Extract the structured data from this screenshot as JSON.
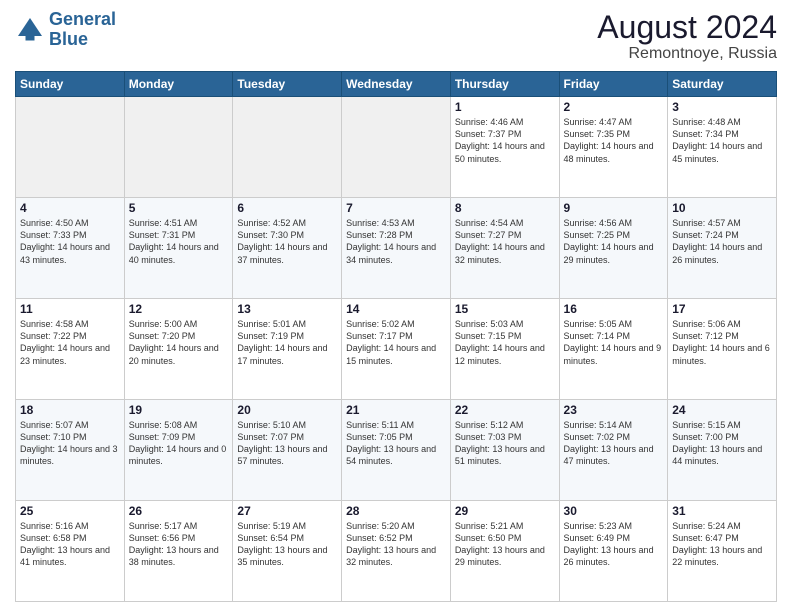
{
  "header": {
    "logo_line1": "General",
    "logo_line2": "Blue",
    "month": "August 2024",
    "location": "Remontnoye, Russia"
  },
  "weekdays": [
    "Sunday",
    "Monday",
    "Tuesday",
    "Wednesday",
    "Thursday",
    "Friday",
    "Saturday"
  ],
  "weeks": [
    [
      {
        "day": "",
        "empty": true
      },
      {
        "day": "",
        "empty": true
      },
      {
        "day": "",
        "empty": true
      },
      {
        "day": "",
        "empty": true
      },
      {
        "day": "1",
        "sunrise": "4:46 AM",
        "sunset": "7:37 PM",
        "daylight": "14 hours and 50 minutes."
      },
      {
        "day": "2",
        "sunrise": "4:47 AM",
        "sunset": "7:35 PM",
        "daylight": "14 hours and 48 minutes."
      },
      {
        "day": "3",
        "sunrise": "4:48 AM",
        "sunset": "7:34 PM",
        "daylight": "14 hours and 45 minutes."
      }
    ],
    [
      {
        "day": "4",
        "sunrise": "4:50 AM",
        "sunset": "7:33 PM",
        "daylight": "14 hours and 43 minutes."
      },
      {
        "day": "5",
        "sunrise": "4:51 AM",
        "sunset": "7:31 PM",
        "daylight": "14 hours and 40 minutes."
      },
      {
        "day": "6",
        "sunrise": "4:52 AM",
        "sunset": "7:30 PM",
        "daylight": "14 hours and 37 minutes."
      },
      {
        "day": "7",
        "sunrise": "4:53 AM",
        "sunset": "7:28 PM",
        "daylight": "14 hours and 34 minutes."
      },
      {
        "day": "8",
        "sunrise": "4:54 AM",
        "sunset": "7:27 PM",
        "daylight": "14 hours and 32 minutes."
      },
      {
        "day": "9",
        "sunrise": "4:56 AM",
        "sunset": "7:25 PM",
        "daylight": "14 hours and 29 minutes."
      },
      {
        "day": "10",
        "sunrise": "4:57 AM",
        "sunset": "7:24 PM",
        "daylight": "14 hours and 26 minutes."
      }
    ],
    [
      {
        "day": "11",
        "sunrise": "4:58 AM",
        "sunset": "7:22 PM",
        "daylight": "14 hours and 23 minutes."
      },
      {
        "day": "12",
        "sunrise": "5:00 AM",
        "sunset": "7:20 PM",
        "daylight": "14 hours and 20 minutes."
      },
      {
        "day": "13",
        "sunrise": "5:01 AM",
        "sunset": "7:19 PM",
        "daylight": "14 hours and 17 minutes."
      },
      {
        "day": "14",
        "sunrise": "5:02 AM",
        "sunset": "7:17 PM",
        "daylight": "14 hours and 15 minutes."
      },
      {
        "day": "15",
        "sunrise": "5:03 AM",
        "sunset": "7:15 PM",
        "daylight": "14 hours and 12 minutes."
      },
      {
        "day": "16",
        "sunrise": "5:05 AM",
        "sunset": "7:14 PM",
        "daylight": "14 hours and 9 minutes."
      },
      {
        "day": "17",
        "sunrise": "5:06 AM",
        "sunset": "7:12 PM",
        "daylight": "14 hours and 6 minutes."
      }
    ],
    [
      {
        "day": "18",
        "sunrise": "5:07 AM",
        "sunset": "7:10 PM",
        "daylight": "14 hours and 3 minutes."
      },
      {
        "day": "19",
        "sunrise": "5:08 AM",
        "sunset": "7:09 PM",
        "daylight": "14 hours and 0 minutes."
      },
      {
        "day": "20",
        "sunrise": "5:10 AM",
        "sunset": "7:07 PM",
        "daylight": "13 hours and 57 minutes."
      },
      {
        "day": "21",
        "sunrise": "5:11 AM",
        "sunset": "7:05 PM",
        "daylight": "13 hours and 54 minutes."
      },
      {
        "day": "22",
        "sunrise": "5:12 AM",
        "sunset": "7:03 PM",
        "daylight": "13 hours and 51 minutes."
      },
      {
        "day": "23",
        "sunrise": "5:14 AM",
        "sunset": "7:02 PM",
        "daylight": "13 hours and 47 minutes."
      },
      {
        "day": "24",
        "sunrise": "5:15 AM",
        "sunset": "7:00 PM",
        "daylight": "13 hours and 44 minutes."
      }
    ],
    [
      {
        "day": "25",
        "sunrise": "5:16 AM",
        "sunset": "6:58 PM",
        "daylight": "13 hours and 41 minutes."
      },
      {
        "day": "26",
        "sunrise": "5:17 AM",
        "sunset": "6:56 PM",
        "daylight": "13 hours and 38 minutes."
      },
      {
        "day": "27",
        "sunrise": "5:19 AM",
        "sunset": "6:54 PM",
        "daylight": "13 hours and 35 minutes."
      },
      {
        "day": "28",
        "sunrise": "5:20 AM",
        "sunset": "6:52 PM",
        "daylight": "13 hours and 32 minutes."
      },
      {
        "day": "29",
        "sunrise": "5:21 AM",
        "sunset": "6:50 PM",
        "daylight": "13 hours and 29 minutes."
      },
      {
        "day": "30",
        "sunrise": "5:23 AM",
        "sunset": "6:49 PM",
        "daylight": "13 hours and 26 minutes."
      },
      {
        "day": "31",
        "sunrise": "5:24 AM",
        "sunset": "6:47 PM",
        "daylight": "13 hours and 22 minutes."
      }
    ]
  ]
}
